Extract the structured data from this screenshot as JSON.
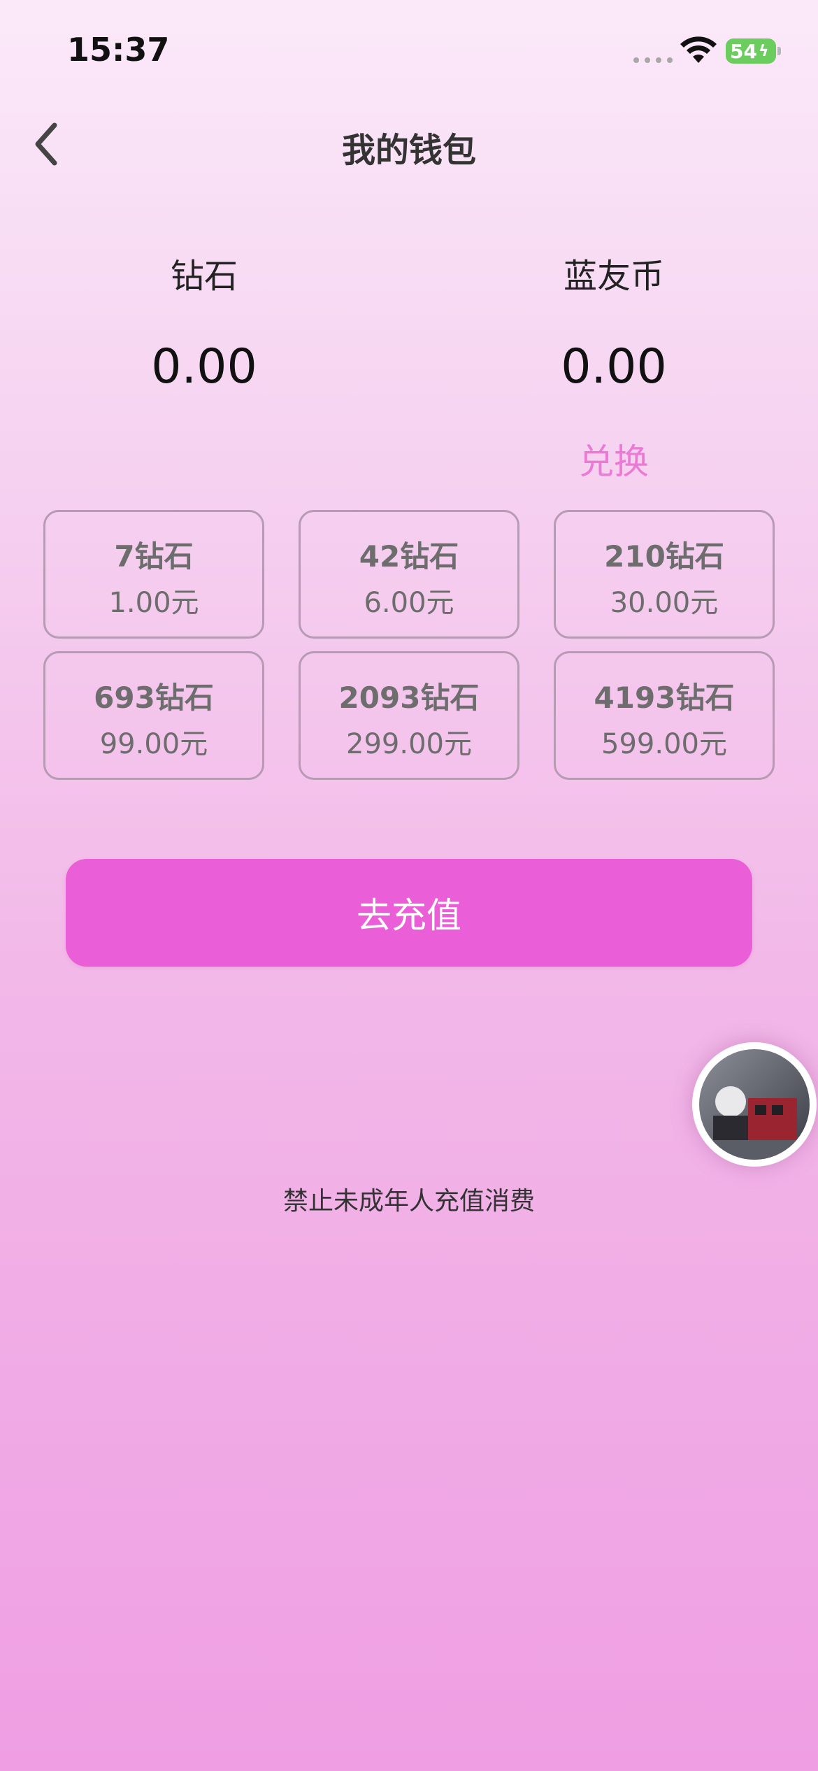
{
  "status_bar": {
    "time": "15:37",
    "battery": "54"
  },
  "nav": {
    "title": "我的钱包",
    "back_icon": "chevron-left-icon"
  },
  "balances": {
    "diamond": {
      "label": "钻石",
      "value": "0.00"
    },
    "coin": {
      "label": "蓝友币",
      "value": "0.00"
    },
    "exchange_label": "兑换"
  },
  "packages": [
    {
      "name": "7钻石",
      "price": "1.00元"
    },
    {
      "name": "42钻石",
      "price": "6.00元"
    },
    {
      "name": "210钻石",
      "price": "30.00元"
    },
    {
      "name": "693钻石",
      "price": "99.00元"
    },
    {
      "name": "2093钻石",
      "price": "299.00元"
    },
    {
      "name": "4193钻石",
      "price": "599.00元"
    }
  ],
  "recharge_button": "去充值",
  "notice": "禁止未成年人充值消费",
  "colors": {
    "accent": "#ea5fd8",
    "exchange_text": "#ec79d4",
    "battery": "#6ccd5f"
  }
}
